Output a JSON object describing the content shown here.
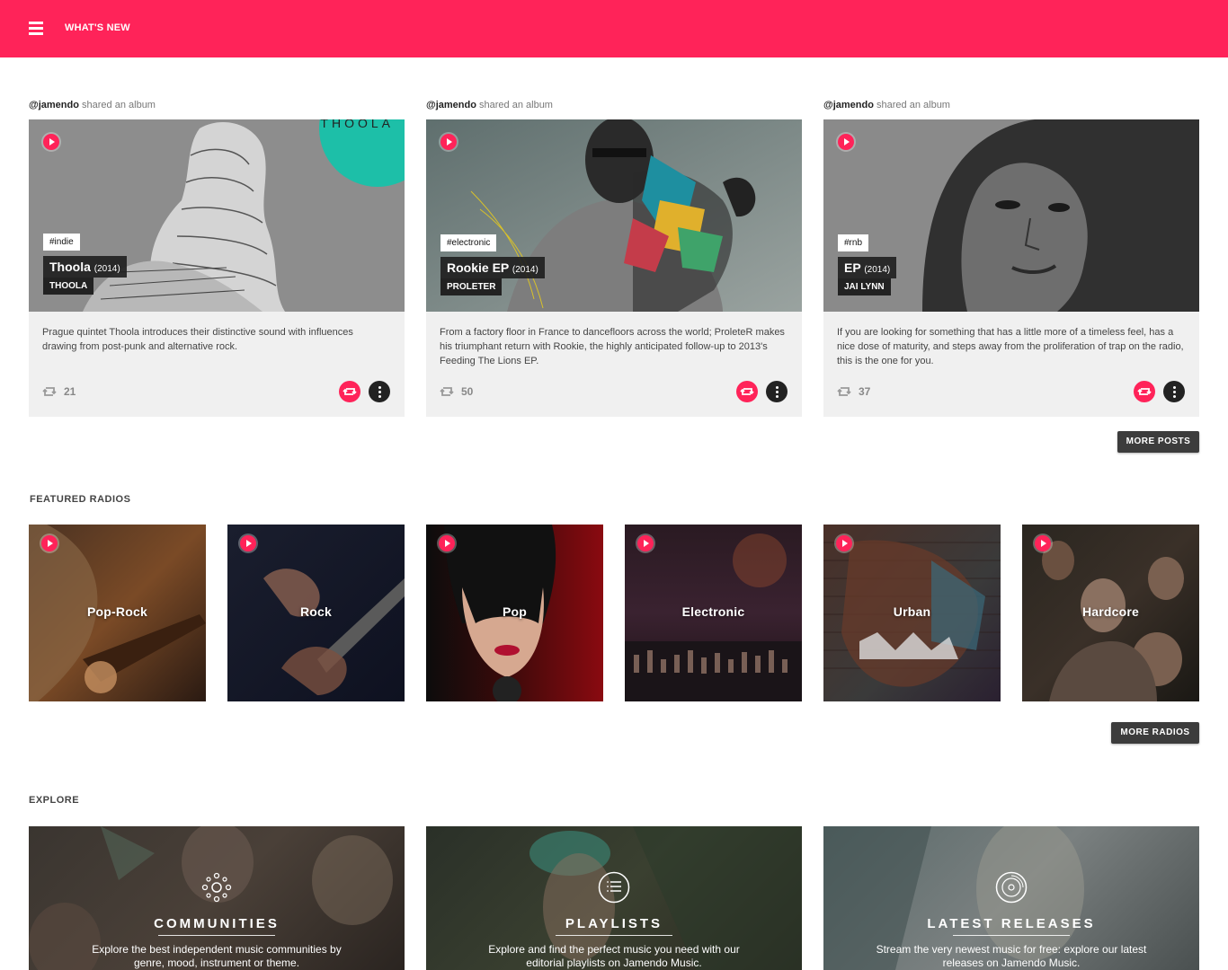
{
  "header": {
    "title": "WHAT'S NEW",
    "menu_icon": "hamburger-menu-icon",
    "color": "#ff2359"
  },
  "posts": [
    {
      "user": "@jamendo",
      "action": "shared an album",
      "tag": "#indie",
      "album": "Thoola",
      "year": "(2014)",
      "artist": "THOOLA",
      "cover_text": "THOOLA",
      "description": "Prague quintet Thoola introduces their distinctive sound with influences drawing from post-punk and alternative rock.",
      "reposts": "21"
    },
    {
      "user": "@jamendo",
      "action": "shared an album",
      "tag": "#electronic",
      "album": "Rookie EP",
      "year": "(2014)",
      "artist": "PROLETER",
      "description": "From a factory floor in France to dancefloors across the world; ProleteR makes his triumphant return with Rookie, the highly anticipated follow-up to 2013's Feeding The Lions EP.",
      "reposts": "50"
    },
    {
      "user": "@jamendo",
      "action": "shared an album",
      "tag": "#rnb",
      "album": "EP",
      "year": "(2014)",
      "artist": "JAI LYNN",
      "description": "If you are looking for something that has a little more of a timeless feel, has a nice dose of maturity, and steps away from the proliferation of trap on the radio, this is the one for you.",
      "reposts": "37"
    }
  ],
  "more_posts_label": "MORE POSTS",
  "featured_radios": {
    "title": "FEATURED RADIOS",
    "items": [
      "Pop-Rock",
      "Rock",
      "Pop",
      "Electronic",
      "Urban",
      "Hardcore"
    ],
    "more_label": "MORE RADIOS"
  },
  "explore": {
    "title": "EXPLORE",
    "items": [
      {
        "title": "COMMUNITIES",
        "icon": "communities-icon",
        "description": "Explore the best independent music communities by genre, mood, instrument or theme."
      },
      {
        "title": "PLAYLISTS",
        "icon": "playlist-icon",
        "description": "Explore and find the perfect music you need with our editorial playlists on Jamendo Music."
      },
      {
        "title": "LATEST RELEASES",
        "icon": "vinyl-disc-icon",
        "description": "Stream the very newest music for free: explore our latest releases on Jamendo Music."
      }
    ]
  },
  "colors": {
    "accent": "#ff2359",
    "dark_button": "#3c3c3c",
    "card_body": "#f0f0f0",
    "teal": "#1dbfa8"
  }
}
